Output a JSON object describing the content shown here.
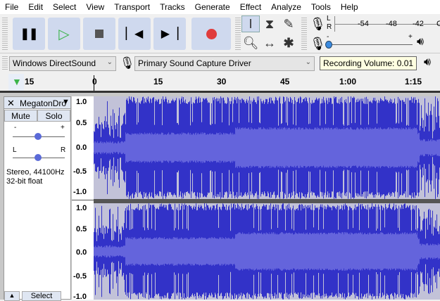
{
  "menu": [
    "File",
    "Edit",
    "Select",
    "View",
    "Transport",
    "Tracks",
    "Generate",
    "Effect",
    "Analyze",
    "Tools",
    "Help"
  ],
  "transport": {
    "pause": "pause-icon",
    "play": "play-icon",
    "stop": "stop-icon",
    "skip_start": "skip-start-icon",
    "skip_end": "skip-end-icon",
    "record": "record-icon",
    "record_color": "#e03c3c",
    "play_color": "#3cb44b"
  },
  "meter": {
    "l": "L",
    "r": "R",
    "ticks": [
      "-54",
      "-48",
      "-42",
      "C"
    ]
  },
  "slider": {
    "minus": "-",
    "plus": "+"
  },
  "devices": {
    "host": "Windows DirectSound",
    "input": "Primary Sound Capture Driver"
  },
  "tooltip": "Recording Volume: 0.01",
  "timeline": {
    "ticks": [
      "15",
      "0",
      "15",
      "30",
      "45",
      "1:00",
      "1:15"
    ]
  },
  "track": {
    "name": "MegatonDro",
    "mute": "Mute",
    "solo": "Solo",
    "gain_minus": "-",
    "gain_plus": "+",
    "pan_l": "L",
    "pan_r": "R",
    "info1": "Stereo, 44100Hz",
    "info2": "32-bit float",
    "select": "Select",
    "gain": 0.5,
    "pan": 0.5,
    "scale": [
      "1.0",
      "0.5",
      "0.0",
      "-0.5",
      "-1.0"
    ]
  },
  "colors": {
    "wave": "#3232c8",
    "rms": "#6464dc",
    "wave_bg": "#c2c2d8"
  }
}
